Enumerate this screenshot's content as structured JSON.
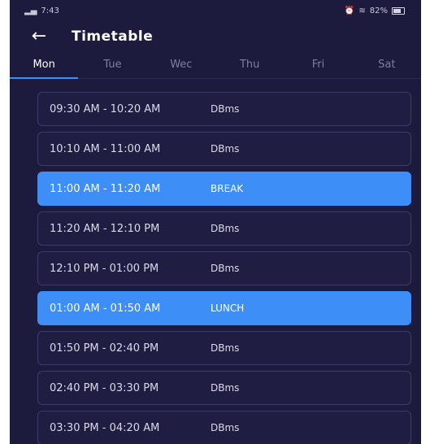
{
  "status": {
    "time": "7:43",
    "battery_text": "82%"
  },
  "appbar": {
    "title": "Timetable",
    "back_icon": "arrow-left-icon"
  },
  "tabs": [
    {
      "label": "Mon",
      "active": true
    },
    {
      "label": "Tue",
      "active": false
    },
    {
      "label": "Wec",
      "active": false
    },
    {
      "label": "Thu",
      "active": false
    },
    {
      "label": "Fri",
      "active": false
    },
    {
      "label": "Sat",
      "active": false
    }
  ],
  "slots": [
    {
      "time": "09:30 AM - 10:20 AM",
      "subject": "DBms",
      "highlight": false
    },
    {
      "time": "10:10 AM - 11:00 AM",
      "subject": "DBms",
      "highlight": false
    },
    {
      "time": "11:00 AM - 11:20 AM",
      "subject": "BREAK",
      "highlight": true
    },
    {
      "time": "11:20 AM - 12:10 PM",
      "subject": "DBms",
      "highlight": false
    },
    {
      "time": "12:10 PM - 01:00 PM",
      "subject": "DBms",
      "highlight": false
    },
    {
      "time": "01:00 AM - 01:50 AM",
      "subject": "LUNCH",
      "highlight": true
    },
    {
      "time": "01:50 PM - 02:40 PM",
      "subject": "DBms",
      "highlight": false
    },
    {
      "time": "02:40 PM - 03:30 PM",
      "subject": "DBms",
      "highlight": false
    },
    {
      "time": "03:30 PM - 04:20 AM",
      "subject": "DBms",
      "highlight": false
    }
  ],
  "colors": {
    "background": "#1c1b3d",
    "accent": "#3e8ef7",
    "card_border": "#3b3b6a"
  }
}
